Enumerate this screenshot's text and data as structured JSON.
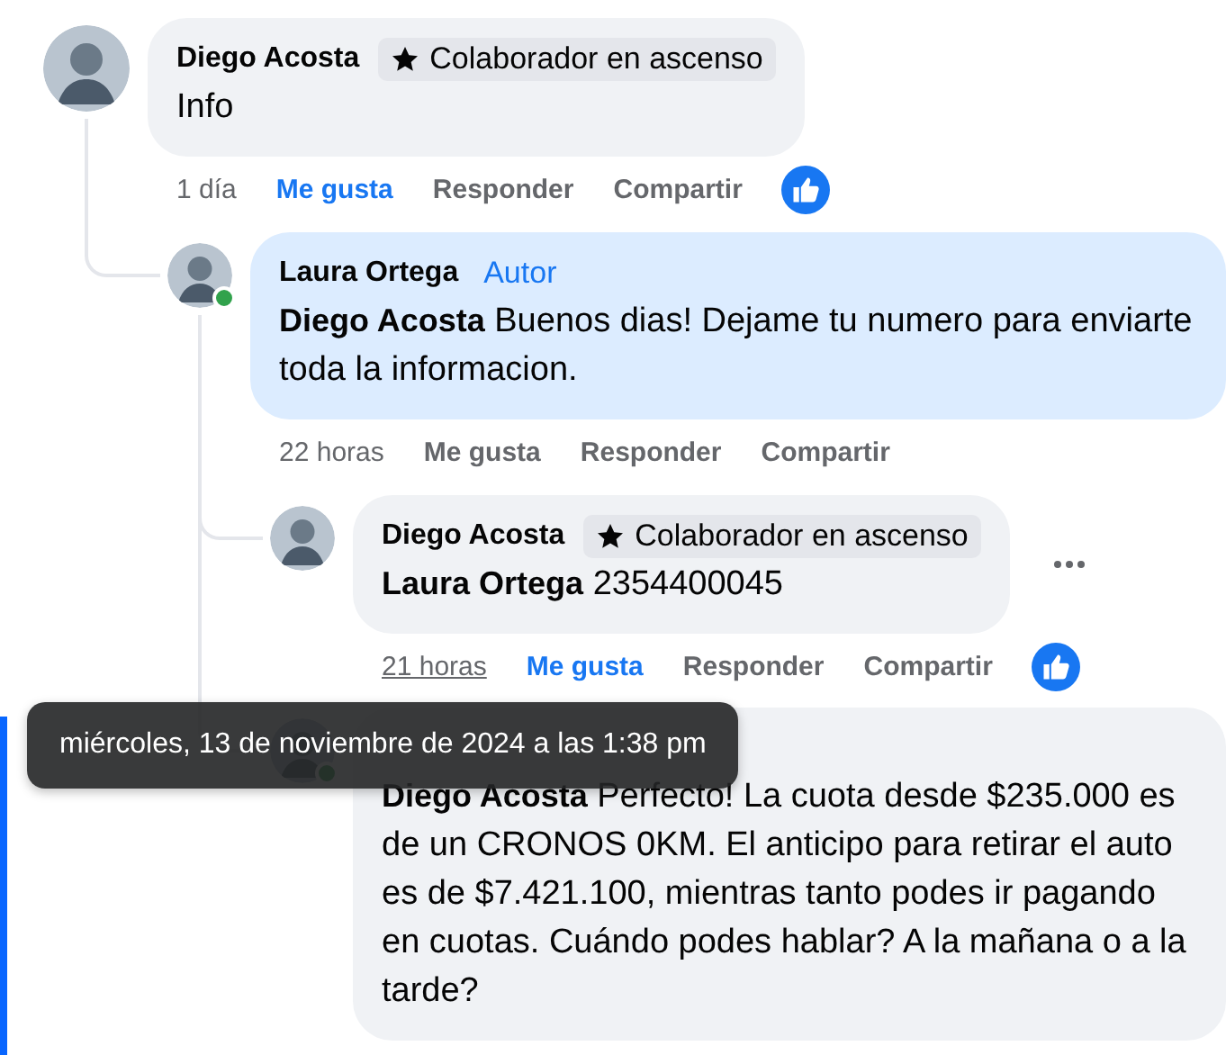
{
  "comments": [
    {
      "author": "Diego Acosta",
      "badge": {
        "kind": "star",
        "label": "Colaborador en ascenso"
      },
      "text": "Info",
      "highlighted": false,
      "online": false,
      "time": "1 día",
      "time_hovered": false,
      "like_label": "Me gusta",
      "liked": true,
      "reply_label": "Responder",
      "share_label": "Compartir",
      "reacted": true,
      "menu": false,
      "children": [
        {
          "author": "Laura Ortega",
          "badge": {
            "kind": "role",
            "label": "Autor"
          },
          "text": "**Diego Acosta** Buenos dias! Dejame tu numero para enviarte toda la informacion.",
          "highlighted": true,
          "online": true,
          "time": "22 horas",
          "time_hovered": false,
          "like_label": "Me gusta",
          "liked": false,
          "reply_label": "Responder",
          "share_label": "Compartir",
          "reacted": false,
          "menu": false,
          "children": [
            {
              "author": "Diego Acosta",
              "badge": {
                "kind": "star",
                "label": "Colaborador en ascenso"
              },
              "text": "**Laura Ortega** 2354400045",
              "highlighted": false,
              "online": false,
              "time": "21 horas",
              "time_hovered": true,
              "like_label": "Me gusta",
              "liked": true,
              "reply_label": "Responder",
              "share_label": "Compartir",
              "reacted": true,
              "menu": true
            },
            {
              "text": "**Diego Acosta** Perfecto! La cuota desde $235.000 es de un CRONOS 0KM. El anticipo para retirar el auto es de $7.421.100, mientras tanto podes ir pagando en cuotas. Cuándo podes hablar? A la mañana o a la tarde?",
              "highlighted": false,
              "online": true
            }
          ]
        }
      ]
    }
  ],
  "tooltip": {
    "text": "miércoles, 13 de noviembre de 2024 a las 1:38 pm"
  }
}
